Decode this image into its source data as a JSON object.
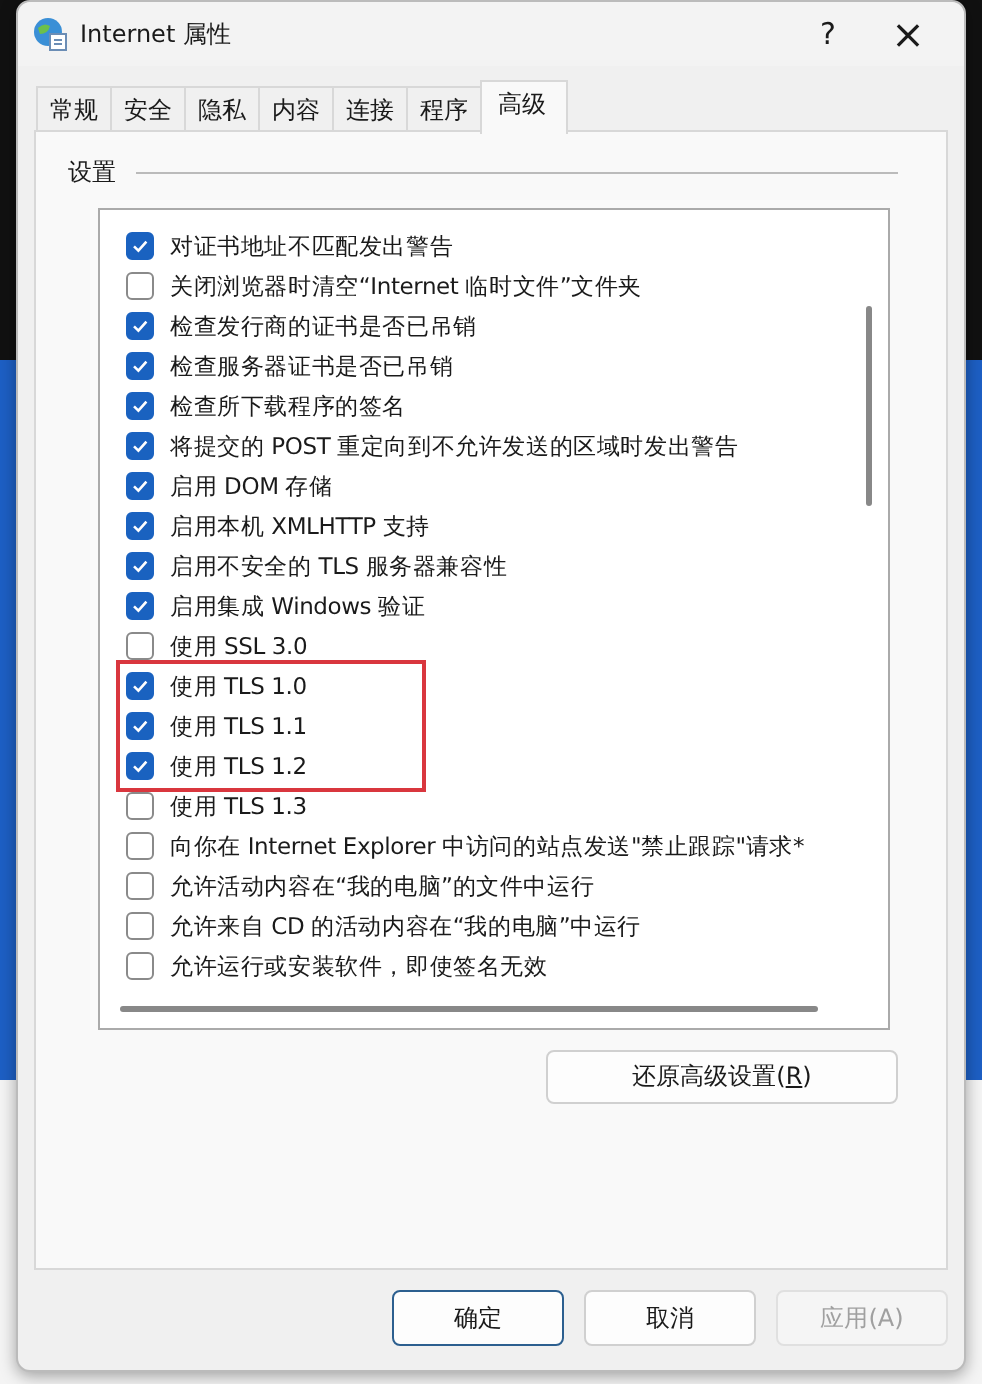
{
  "window": {
    "title": "Internet 属性",
    "help": "?",
    "close": "×"
  },
  "tabs": [
    {
      "label": "常规",
      "selected": false
    },
    {
      "label": "安全",
      "selected": false
    },
    {
      "label": "隐私",
      "selected": false
    },
    {
      "label": "内容",
      "selected": false
    },
    {
      "label": "连接",
      "selected": false
    },
    {
      "label": "程序",
      "selected": false
    },
    {
      "label": "高级",
      "selected": true
    }
  ],
  "group_label": "设置",
  "settings": [
    {
      "label": "对证书地址不匹配发出警告",
      "checked": true,
      "highlighted": false
    },
    {
      "label": "关闭浏览器时清空“Internet 临时文件”文件夹",
      "checked": false,
      "highlighted": false
    },
    {
      "label": "检查发行商的证书是否已吊销",
      "checked": true,
      "highlighted": false
    },
    {
      "label": "检查服务器证书是否已吊销",
      "checked": true,
      "highlighted": false
    },
    {
      "label": "检查所下载程序的签名",
      "checked": true,
      "highlighted": false
    },
    {
      "label": "将提交的 POST 重定向到不允许发送的区域时发出警告",
      "checked": true,
      "highlighted": false
    },
    {
      "label": "启用 DOM 存储",
      "checked": true,
      "highlighted": false
    },
    {
      "label": "启用本机 XMLHTTP 支持",
      "checked": true,
      "highlighted": false
    },
    {
      "label": "启用不安全的 TLS 服务器兼容性",
      "checked": true,
      "highlighted": false
    },
    {
      "label": "启用集成 Windows 验证",
      "checked": true,
      "highlighted": false
    },
    {
      "label": "使用 SSL 3.0",
      "checked": false,
      "highlighted": false
    },
    {
      "label": "使用 TLS 1.0",
      "checked": true,
      "highlighted": true
    },
    {
      "label": "使用 TLS 1.1",
      "checked": true,
      "highlighted": true
    },
    {
      "label": "使用 TLS 1.2",
      "checked": true,
      "highlighted": true
    },
    {
      "label": "使用 TLS 1.3",
      "checked": false,
      "highlighted": false
    },
    {
      "label": "向你在 Internet Explorer 中访问的站点发送\"禁止跟踪\"请求*",
      "checked": false,
      "highlighted": false
    },
    {
      "label": "允许活动内容在“我的电脑”的文件中运行",
      "checked": false,
      "highlighted": false
    },
    {
      "label": "允许来自 CD 的活动内容在“我的电脑”中运行",
      "checked": false,
      "highlighted": false
    },
    {
      "label": "允许运行或安装软件，即使签名无效",
      "checked": false,
      "highlighted": false
    }
  ],
  "reset_button": {
    "label": "还原高级设置(",
    "mnemonic": "R",
    "suffix": ")"
  },
  "buttons": [
    {
      "label": "确定",
      "kind": "default",
      "disabled": false
    },
    {
      "label": "取消",
      "kind": "normal",
      "disabled": false
    },
    {
      "label": "应用(A)",
      "kind": "normal",
      "disabled": true
    }
  ]
}
